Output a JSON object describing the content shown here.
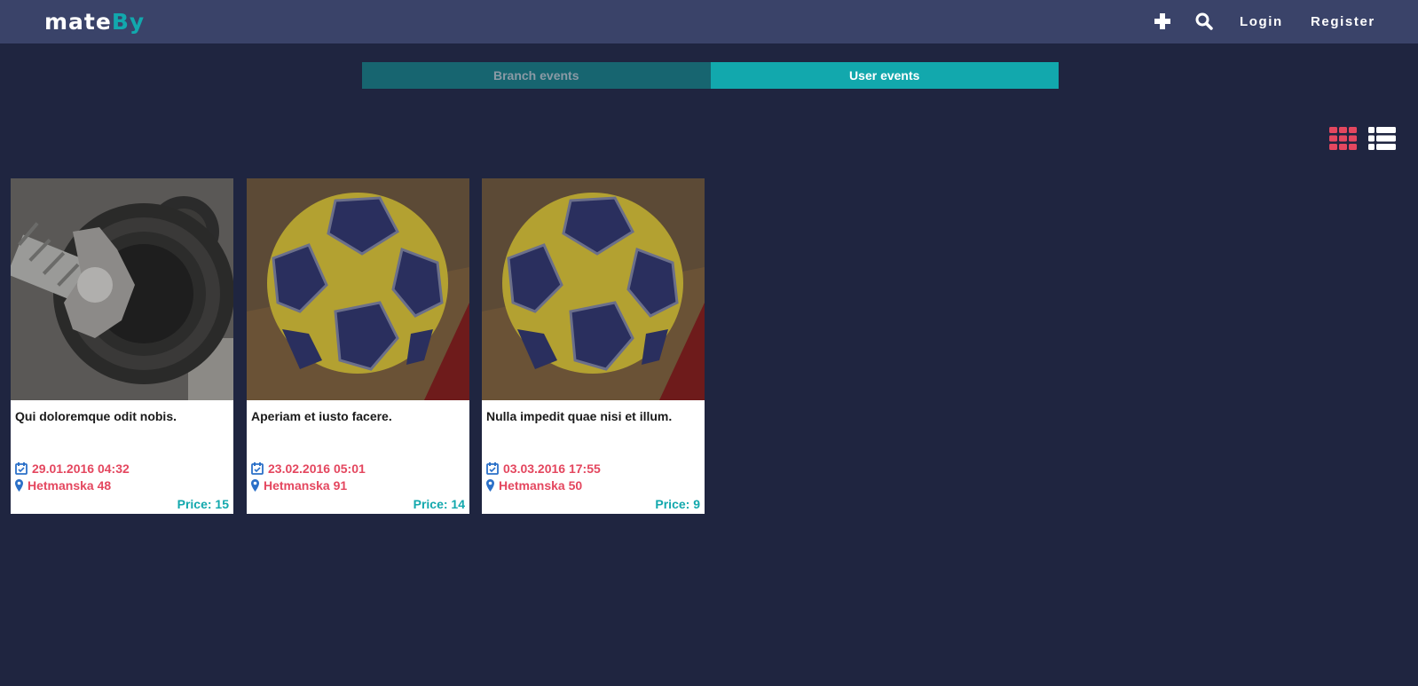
{
  "brand": {
    "part1": "mate",
    "part2": "By"
  },
  "nav": {
    "add_icon": "plus-icon",
    "search_icon": "search-icon",
    "login": "Login",
    "register": "Register"
  },
  "tabs": [
    {
      "label": "Branch events",
      "active": false
    },
    {
      "label": "User events",
      "active": true
    }
  ],
  "view_modes": {
    "grid_icon": "grid-view-icon",
    "list_icon": "list-view-icon",
    "active": "grid"
  },
  "colors": {
    "background": "#1f2540",
    "navbar": "#3a4369",
    "accent": "#12a8ad",
    "highlight": "#e4475f"
  },
  "events": [
    {
      "image": "dumbbell-photo",
      "title": "Qui doloremque odit nobis.",
      "date": "29.01.2016 04:32",
      "location": "Hetmanska 48",
      "price_label": "Price:",
      "price": "15"
    },
    {
      "image": "handball-photo",
      "title": "Aperiam et iusto facere.",
      "date": "23.02.2016 05:01",
      "location": "Hetmanska 91",
      "price_label": "Price:",
      "price": "14"
    },
    {
      "image": "handball-photo",
      "title": "Nulla impedit quae nisi et illum.",
      "date": "03.03.2016 17:55",
      "location": "Hetmanska 50",
      "price_label": "Price:",
      "price": "9"
    }
  ]
}
